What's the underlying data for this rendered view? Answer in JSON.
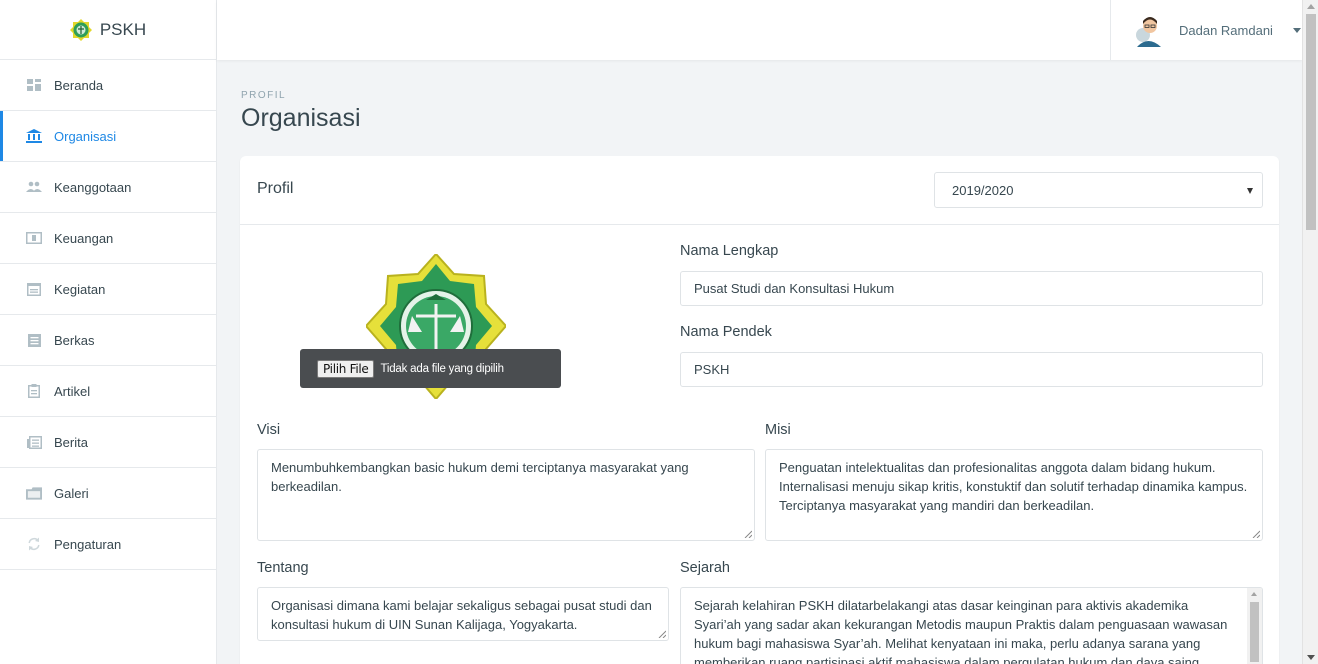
{
  "brand": {
    "name": "PSKH",
    "icon": "organization-logo-icon"
  },
  "sidebar": {
    "items": [
      {
        "label": "Beranda",
        "icon": "dashboard-icon"
      },
      {
        "label": "Organisasi",
        "icon": "institution-icon",
        "active": true
      },
      {
        "label": "Keanggotaan",
        "icon": "members-icon"
      },
      {
        "label": "Keuangan",
        "icon": "money-icon"
      },
      {
        "label": "Kegiatan",
        "icon": "calendar-icon"
      },
      {
        "label": "Berkas",
        "icon": "file-icon"
      },
      {
        "label": "Artikel",
        "icon": "clipboard-icon"
      },
      {
        "label": "Berita",
        "icon": "news-icon"
      },
      {
        "label": "Galeri",
        "icon": "gallery-icon"
      },
      {
        "label": "Pengaturan",
        "icon": "refresh-icon"
      }
    ]
  },
  "topbar": {
    "user_name": "Dadan Ramdani"
  },
  "page": {
    "pretitle": "PROFIL",
    "title": "Organisasi"
  },
  "card": {
    "title": "Profil",
    "period_select": {
      "value": "2019/2020"
    },
    "file_input": {
      "button_label": "Pilih File",
      "status": "Tidak ada file yang dipilih"
    },
    "fields": {
      "nama_lengkap": {
        "label": "Nama Lengkap",
        "value": "Pusat Studi dan Konsultasi Hukum"
      },
      "nama_pendek": {
        "label": "Nama Pendek",
        "value": "PSKH"
      },
      "visi": {
        "label": "Visi",
        "value": "Menumbuhkembangkan basic hukum demi terciptanya masyarakat yang berkeadilan."
      },
      "misi": {
        "label": "Misi",
        "value": "Penguatan intelektualitas dan profesionalitas anggota dalam bidang hukum.\nInternalisasi menuju sikap kritis, konstuktif dan solutif terhadap dinamika kampus.\nTerciptanya masyarakat yang mandiri dan berkeadilan."
      },
      "tentang": {
        "label": "Tentang",
        "value": "Organisasi dimana kami belajar sekaligus sebagai pusat studi dan konsultasi hukum di UIN Sunan Kalijaga, Yogyakarta."
      },
      "sejarah": {
        "label": "Sejarah",
        "value": "Sejarah kelahiran PSKH dilatarbelakangi atas dasar keinginan para aktivis akademika Syari’ah yang sadar akan kekurangan Metodis maupun Praktis dalam penguasaan wawasan hukum bagi mahasiswa Syar’ah. Melihat kenyataan ini maka, perlu adanya sarana yang memberikan ruang partisipasi aktif mahasiswa dalam pergulatan hukum dan daya saing"
      }
    }
  },
  "colors": {
    "accent": "#1e88e5",
    "text": "#37474f",
    "background": "#f2f4f6"
  }
}
